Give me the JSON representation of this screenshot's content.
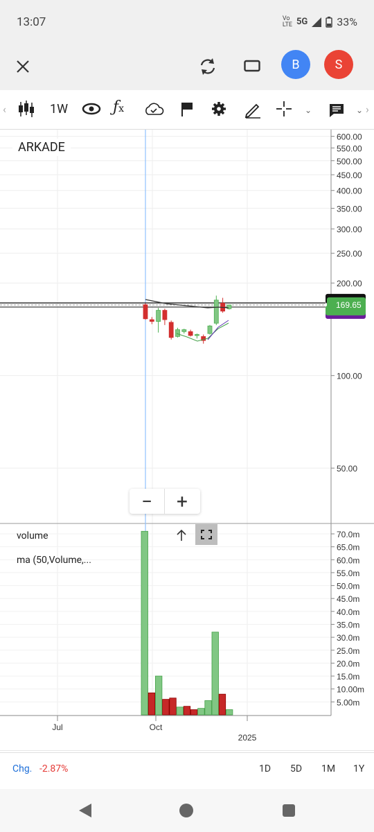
{
  "status": {
    "time": "13:07",
    "network": "5G",
    "battery": "33%",
    "volte": "LTE"
  },
  "appbar": {
    "avatar_b": "B",
    "avatar_s": "S"
  },
  "toolbar": {
    "interval": "1W"
  },
  "chart": {
    "symbol": "ARKADE",
    "price_label": "169.65",
    "price_axis_ticks": [
      "600.00",
      "550.00",
      "500.00",
      "450.00",
      "400.00",
      "350.00",
      "300.00",
      "250.00",
      "200.00",
      "100.00",
      "50.00"
    ],
    "volume_axis_ticks": [
      "70.0m",
      "65.0m",
      "60.0m",
      "55.0m",
      "50.0m",
      "45.0m",
      "40.0m",
      "35.0m",
      "30.0m",
      "25.0m",
      "20.0m",
      "15.0m",
      "10.00m",
      "5.00m"
    ],
    "x_labels": [
      "Jul",
      "Oct",
      "2025"
    ],
    "indicators": {
      "volume": "volume",
      "ma": "ma (50,Volume,..."
    },
    "zoom": {
      "minus": "−",
      "plus": "+"
    }
  },
  "chart_data": {
    "type": "candlestick",
    "symbol": "ARKADE",
    "scale": "log",
    "ylim": [
      40,
      650
    ],
    "last_price": 169.65,
    "candles_weekly": [
      {
        "o": 170,
        "h": 172,
        "l": 152,
        "c": 153,
        "up": false
      },
      {
        "o": 152,
        "h": 155,
        "l": 147,
        "c": 150,
        "up": false
      },
      {
        "o": 150,
        "h": 166,
        "l": 138,
        "c": 163,
        "up": true
      },
      {
        "o": 163,
        "h": 165,
        "l": 146,
        "c": 152,
        "up": false
      },
      {
        "o": 149,
        "h": 151,
        "l": 131,
        "c": 133,
        "up": false
      },
      {
        "o": 134,
        "h": 143,
        "l": 133,
        "c": 141,
        "up": true
      },
      {
        "o": 141,
        "h": 142,
        "l": 137,
        "c": 139,
        "up": true
      },
      {
        "o": 139,
        "h": 141,
        "l": 134,
        "c": 135,
        "up": false
      },
      {
        "o": 135,
        "h": 137,
        "l": 132,
        "c": 136,
        "up": true
      },
      {
        "o": 134,
        "h": 136,
        "l": 127,
        "c": 130,
        "up": false
      },
      {
        "o": 137,
        "h": 146,
        "l": 136,
        "c": 145,
        "up": true
      },
      {
        "o": 148,
        "h": 182,
        "l": 146,
        "c": 176,
        "up": true
      },
      {
        "o": 172,
        "h": 179,
        "l": 160,
        "c": 162,
        "up": false
      },
      {
        "o": 165,
        "h": 170,
        "l": 164,
        "c": 169.65,
        "up": true
      }
    ],
    "volume_m": [
      71,
      8.5,
      15,
      6,
      6.5,
      3,
      3.3,
      2,
      2.5,
      5.5,
      32,
      8,
      2
    ],
    "volume_up": [
      true,
      false,
      true,
      false,
      false,
      true,
      false,
      false,
      true,
      true,
      true,
      false,
      true
    ],
    "x_labels": [
      "Jul",
      "Oct",
      "2025"
    ]
  },
  "bottom": {
    "chg_label": "Chg.",
    "chg_value": "-2.87%",
    "ranges": [
      "1D",
      "5D",
      "1M",
      "1Y"
    ]
  },
  "colors": {
    "up": "#81c784",
    "down": "#d32f2f",
    "price_tag": "#4caf50",
    "accent_blue": "#4285f4",
    "accent_red": "#ea4335"
  }
}
